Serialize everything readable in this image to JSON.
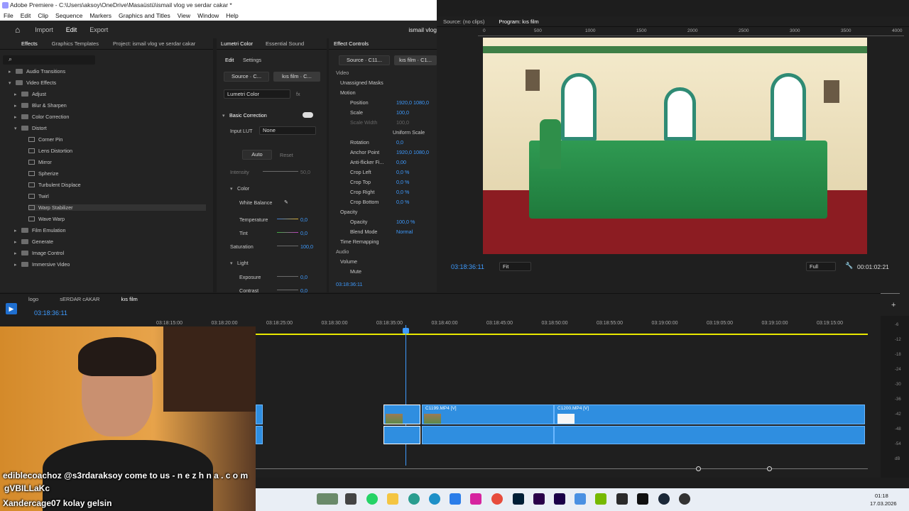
{
  "window": {
    "title": "Adobe Premiere - C:\\Users\\aksoy\\OneDrive\\Masaüstü\\ismail vlog ve serdar cakar *",
    "menu": [
      "File",
      "Edit",
      "Clip",
      "Sequence",
      "Markers",
      "Graphics and Titles",
      "View",
      "Window",
      "Help"
    ]
  },
  "topnav": {
    "import": "Import",
    "edit": "Edit",
    "export": "Export",
    "project_name": "ismail vlog"
  },
  "effects_panel": {
    "tabs": [
      "Effects",
      "Graphics Templates",
      "Project: ismail vlog ve serdar cakar"
    ],
    "tree": [
      {
        "label": "Audio Transitions",
        "kind": "folder",
        "level": 1,
        "expanded": false
      },
      {
        "label": "Video Effects",
        "kind": "folder",
        "level": 1,
        "expanded": true
      },
      {
        "label": "Adjust",
        "kind": "folder",
        "level": 2,
        "expanded": false
      },
      {
        "label": "Blur & Sharpen",
        "kind": "folder",
        "level": 2,
        "expanded": false
      },
      {
        "label": "Color Correction",
        "kind": "folder",
        "level": 2,
        "expanded": false
      },
      {
        "label": "Distort",
        "kind": "folder",
        "level": 2,
        "expanded": true
      },
      {
        "label": "Corner Pin",
        "kind": "effect",
        "level": 3
      },
      {
        "label": "Lens Distortion",
        "kind": "effect",
        "level": 3
      },
      {
        "label": "Mirror",
        "kind": "effect",
        "level": 3
      },
      {
        "label": "Spherize",
        "kind": "effect",
        "level": 3
      },
      {
        "label": "Turbulent Displace",
        "kind": "effect",
        "level": 3
      },
      {
        "label": "Twirl",
        "kind": "effect",
        "level": 3
      },
      {
        "label": "Warp Stabilizer",
        "kind": "effect",
        "level": 3,
        "selected": true
      },
      {
        "label": "Wave Warp",
        "kind": "effect",
        "level": 3
      },
      {
        "label": "Film Emulation",
        "kind": "folder",
        "level": 2,
        "expanded": false
      },
      {
        "label": "Generate",
        "kind": "folder",
        "level": 2,
        "expanded": false
      },
      {
        "label": "Image Control",
        "kind": "folder",
        "level": 2,
        "expanded": false
      },
      {
        "label": "Immersive Video",
        "kind": "folder",
        "level": 2,
        "expanded": false
      }
    ]
  },
  "lumetri": {
    "tabs": [
      "Lumetri Color",
      "Essential Sound"
    ],
    "subtabs": [
      "Edit",
      "Settings"
    ],
    "source_tab": "Source · C...",
    "seq_tab": "kıs film · C...",
    "effect_select": "Lumetri Color",
    "section_basic": "Basic Correction",
    "input_lut_label": "Input LUT",
    "input_lut_value": "None",
    "auto": "Auto",
    "reset": "Reset",
    "intensity_label": "Intensity",
    "intensity_value": "50,0",
    "color_section": "Color",
    "white_balance": "White Balance",
    "temperature_label": "Temperature",
    "temperature_value": "0,0",
    "tint_label": "Tint",
    "tint_value": "0,0",
    "saturation_label": "Saturation",
    "saturation_value": "100,0",
    "light_section": "Light",
    "exposure_label": "Exposure",
    "exposure_value": "0,0",
    "contrast_label": "Contrast",
    "contrast_value": "0,0"
  },
  "effect_controls": {
    "tab": "Effect Controls",
    "source_tab": "Source · C11...",
    "seq_tab": "kıs film · C1...",
    "video_label": "Video",
    "masks": "Unassigned Masks",
    "motion": "Motion",
    "position_label": "Position",
    "position_x": "1920,0",
    "position_y": "1080,0",
    "scale_label": "Scale",
    "scale_value": "100,0",
    "scale_width_label": "Scale Width",
    "scale_width_value": "100,0",
    "uniform_scale": "Uniform Scale",
    "rotation_label": "Rotation",
    "rotation_value": "0,0",
    "anchor_label": "Anchor Point",
    "anchor_x": "1920,0",
    "anchor_y": "1080,0",
    "antiflicker_label": "Anti-flicker Fi...",
    "antiflicker_value": "0,00",
    "crop_left_label": "Crop Left",
    "crop_left_value": "0,0 %",
    "crop_top_label": "Crop Top",
    "crop_top_value": "0,0 %",
    "crop_right_label": "Crop Right",
    "crop_right_value": "0,0 %",
    "crop_bottom_label": "Crop Bottom",
    "crop_bottom_value": "0,0 %",
    "opacity_section": "Opacity",
    "opacity_label": "Opacity",
    "opacity_value": "100,0 %",
    "blend_label": "Blend Mode",
    "blend_value": "Normal",
    "time_remap": "Time Remapping",
    "audio_label": "Audio",
    "volume_label": "Volume",
    "mute_label": "Mute",
    "timecode": "03:18:36:11"
  },
  "program_monitor": {
    "source_tab": "Source: (no clips)",
    "program_tab": "Program: kıs film",
    "ruler_ticks": [
      "0",
      "500",
      "1000",
      "1500",
      "2000",
      "2500",
      "3000",
      "3500",
      "4000"
    ],
    "timecode": "03:18:36:11",
    "fit": "Fit",
    "quality": "Full",
    "duration": "00:01:02:21"
  },
  "timeline": {
    "seq_tabs": [
      "logo",
      "sERDAR cAKAR",
      "kıs film"
    ],
    "timecode": "03:18:36:11",
    "ruler": [
      "03:18:15:00",
      "03:18:20:00",
      "03:18:25:00",
      "03:18:30:00",
      "03:18:35:00",
      "03:18:40:00",
      "03:18:45:00",
      "03:18:50:00",
      "03:18:55:00",
      "03:19:00:00",
      "03:19:05:00",
      "03:19:10:00",
      "03:19:15:00"
    ],
    "clip1": "C1199.MP4 [V]",
    "clip2": "C1200.MP4 [V]",
    "meter_labels": [
      "-6",
      "-12",
      "-18",
      "-24",
      "-30",
      "-36",
      "-42",
      "-48",
      "-54",
      "dB"
    ]
  },
  "webcam_overlay": {
    "line1": "ediblecoachoz @s3rdaraksoy come to us - n e z h n a . c o m",
    "line2": "gVBILLaKc",
    "line3": "Xandercage07  kolay gelsin"
  },
  "taskbar": {
    "time": "01:18",
    "date": "17.03.2026"
  },
  "colors": {
    "accent": "#3e9bff",
    "clip": "#2f8ee0",
    "playhead": "#3e9bff"
  }
}
